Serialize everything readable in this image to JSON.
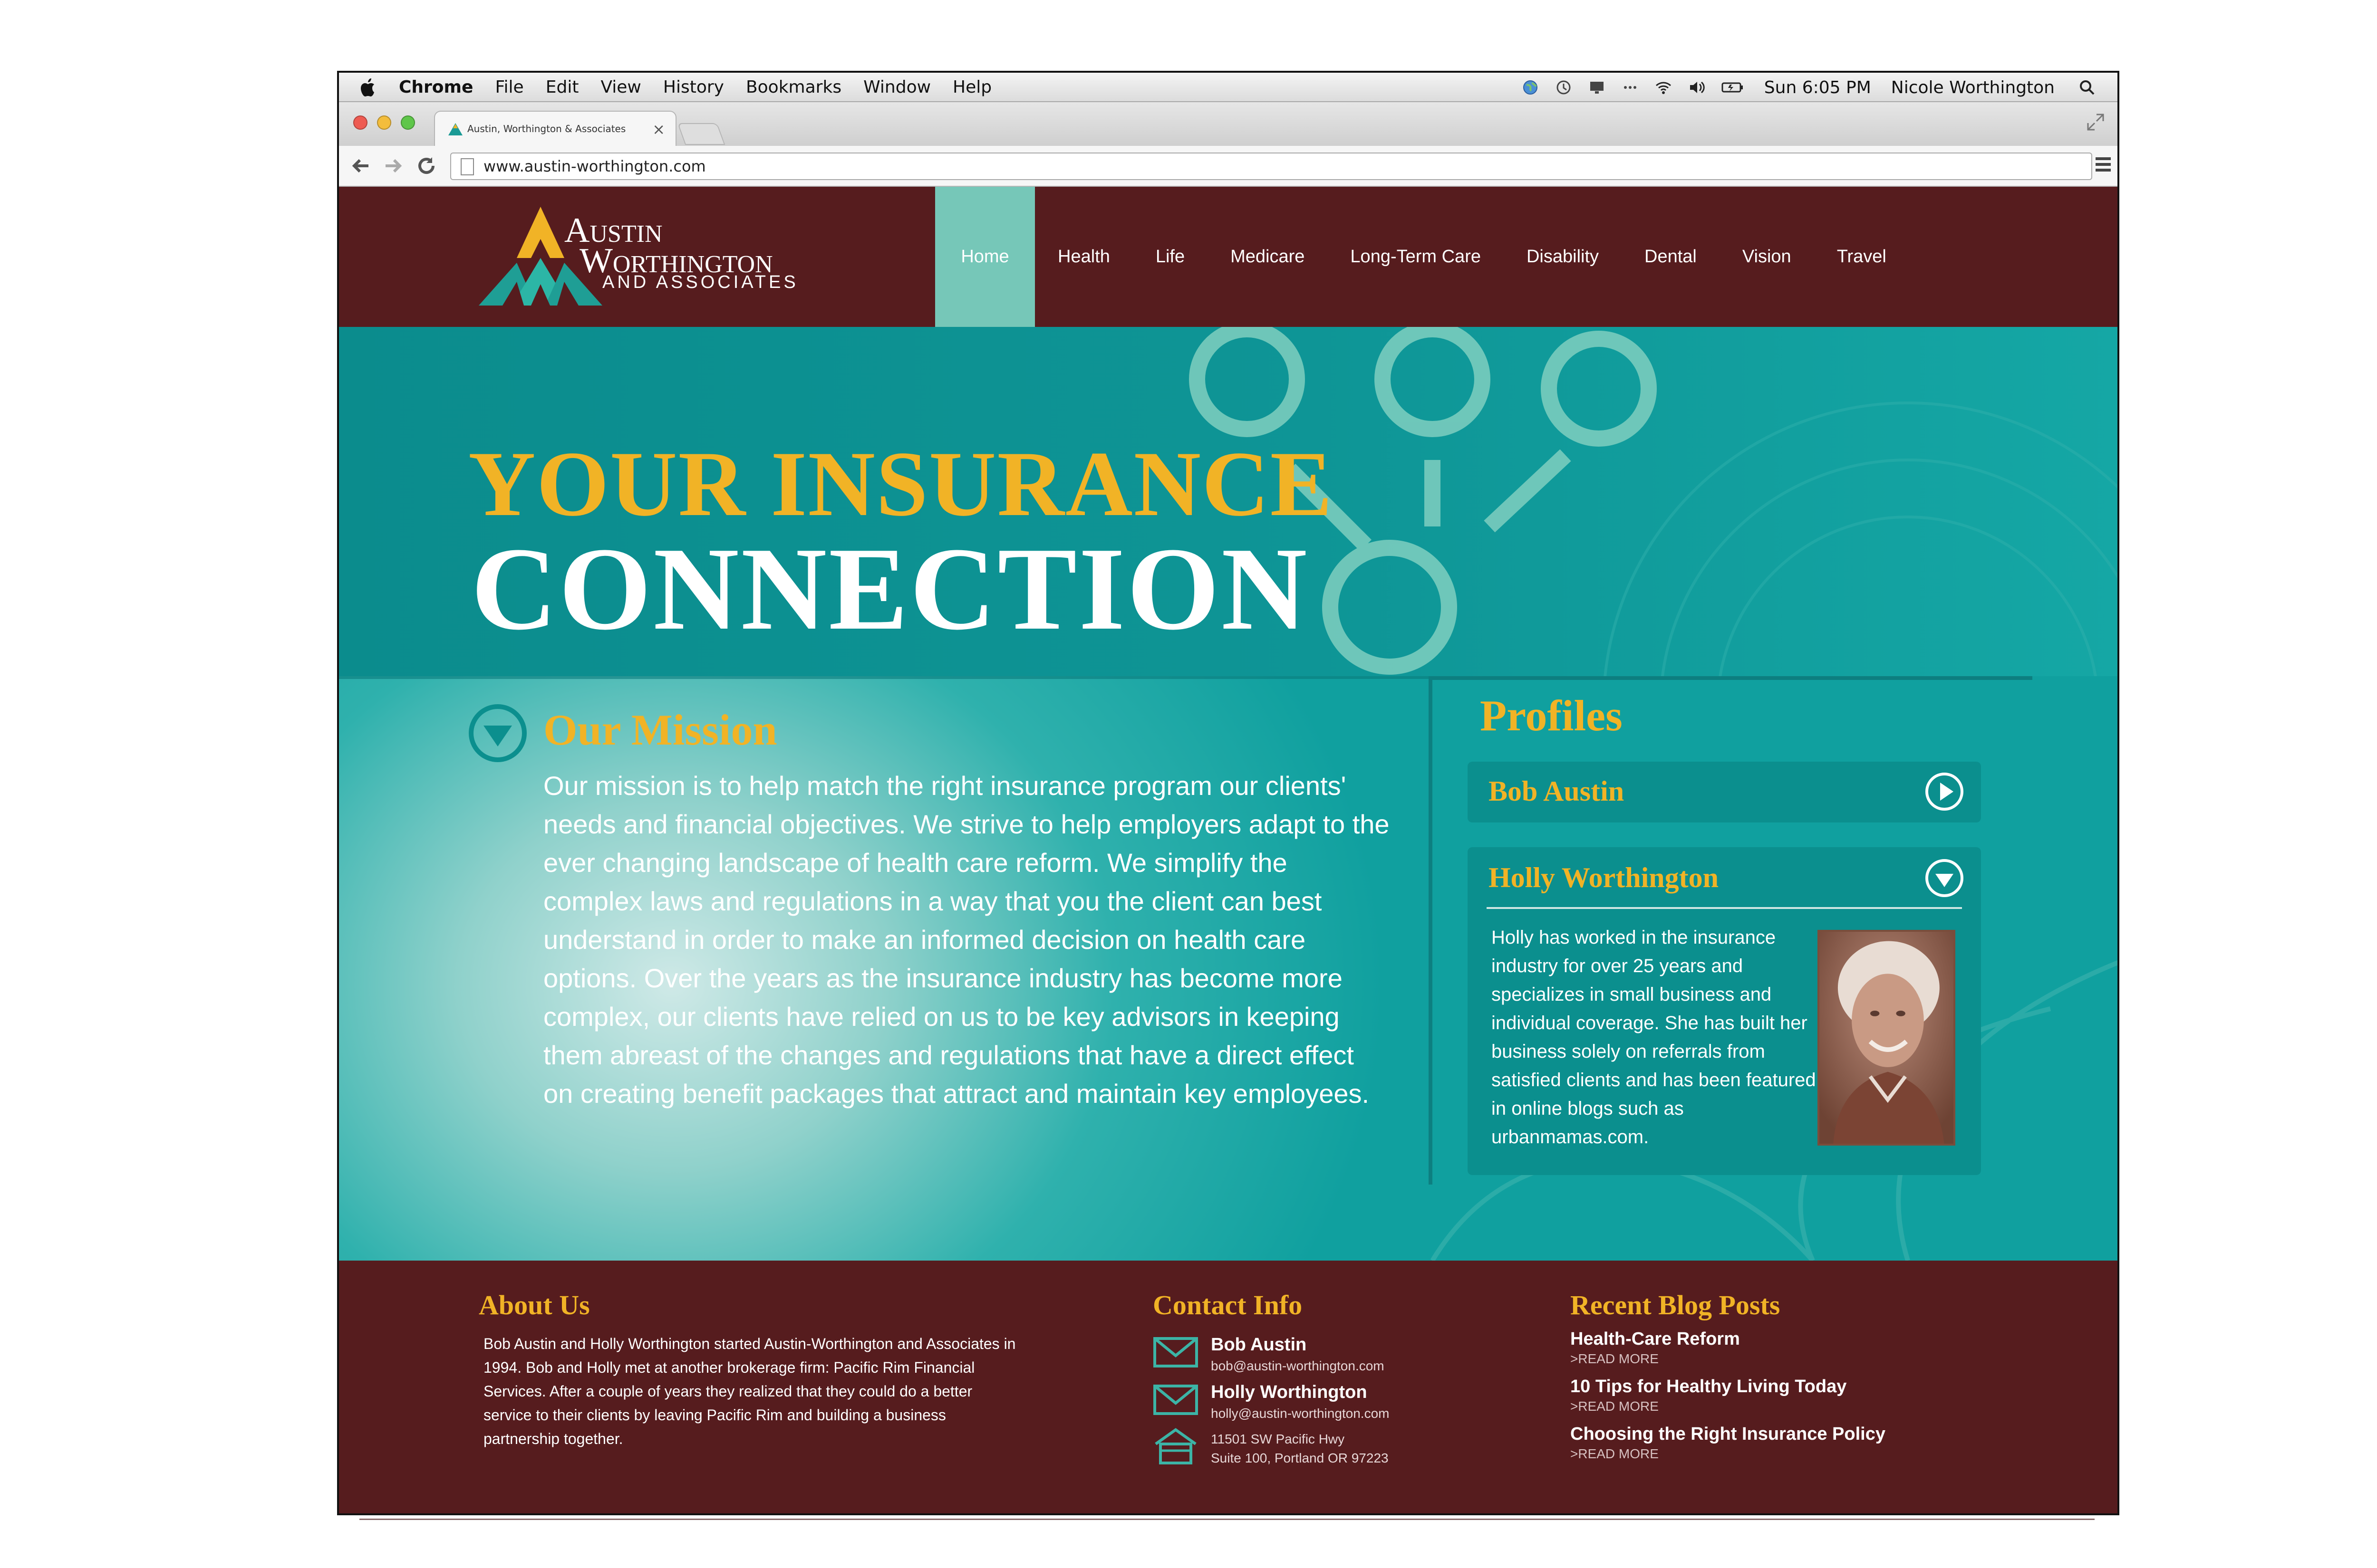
{
  "menubar": {
    "items": [
      "Chrome",
      "File",
      "Edit",
      "View",
      "History",
      "Bookmarks",
      "Window",
      "Help"
    ],
    "clock": "Sun 6:05 PM",
    "user": "Nicole Worthington"
  },
  "browser": {
    "tab_title": "Austin, Worthington & Associates",
    "tab_close": "×",
    "url": "www.austin-worthington.com"
  },
  "site": {
    "logo": {
      "line1": "Austin",
      "line2": "Worthington",
      "line3": "and Associates"
    },
    "nav": [
      "Home",
      "Health",
      "Life",
      "Medicare",
      "Long-Term Care",
      "Disability",
      "Dental",
      "Vision",
      "Travel"
    ],
    "hero": {
      "line1": "YOUR INSURANCE",
      "line2": "CONNECTION"
    },
    "mission": {
      "title": "Our Mission",
      "body": "Our mission is to help match the right insurance program our clients' needs and financial objectives. We strive to help employers adapt to the ever changing landscape of health care reform. We simplify the complex laws and regulations in a way that you the client can best understand in order to make an informed decision on health care options. Over the years as the insurance industry has become more complex, our clients have relied on us to be key advisors in keeping them abreast of the changes and regulations that have a direct effect on creating benefit packages that attract and maintain key employees."
    },
    "profiles": {
      "title": "Profiles",
      "bob": {
        "name": "Bob Austin"
      },
      "holly": {
        "name": "Holly Worthington",
        "bio": "Holly has worked in the insurance industry for over 25 years and specializes in small business and individual coverage. She has built her business solely on referrals from satisfied clients and has been featured in online blogs such as urbanmamas.com."
      }
    },
    "footer": {
      "about": {
        "title": "About Us",
        "body": "Bob Austin and Holly Worthington started Austin-Worthington and Associates in 1994. Bob and Holly met at another brokerage firm: Pacific Rim Financial Services. After a couple of years they realized that they could do a better service to their clients by leaving Pacific Rim and building a business partnership together."
      },
      "contact": {
        "title": "Contact Info",
        "bob_name": "Bob Austin",
        "bob_email": "bob@austin-worthington.com",
        "holly_name": "Holly Worthington",
        "holly_email": "holly@austin-worthington.com",
        "address1": "11501 SW Pacific Hwy",
        "address2": "Suite 100, Portland OR 97223"
      },
      "blog": {
        "title": "Recent Blog Posts",
        "posts": [
          {
            "title": "Health-Care Reform",
            "more": ">READ MORE"
          },
          {
            "title": "10 Tips for Healthy Living Today",
            "more": ">READ MORE"
          },
          {
            "title": "Choosing the Right Insurance Policy",
            "more": ">READ MORE"
          }
        ]
      }
    }
  },
  "colors": {
    "maroon": "#561c1e",
    "teal": "#0e9596",
    "mint": "#76c7b8",
    "gold": "#f1b326"
  }
}
